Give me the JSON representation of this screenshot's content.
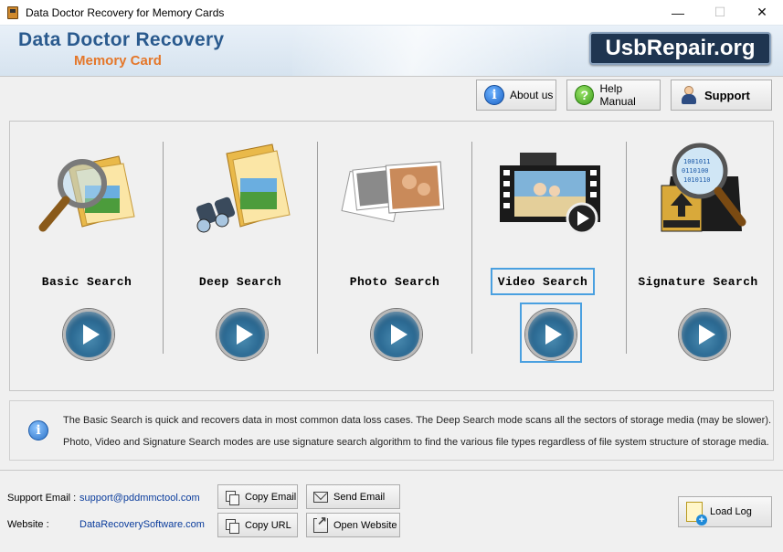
{
  "window": {
    "title": "Data Doctor Recovery for Memory Cards",
    "controls": [
      "—",
      "☐",
      "✕"
    ]
  },
  "banner": {
    "title": "Data Doctor Recovery",
    "subtitle": "Memory Card",
    "badge": "UsbRepair.org"
  },
  "toolbar": {
    "about_label": "About us",
    "help_label": "Help Manual",
    "support_label": "Support"
  },
  "searches": [
    {
      "label": "Basic Search",
      "icon": "magnifier-folder-icon",
      "selected": false
    },
    {
      "label": "Deep Search",
      "icon": "binoculars-folder-icon",
      "selected": false
    },
    {
      "label": "Photo Search",
      "icon": "photos-icon",
      "selected": false
    },
    {
      "label": "Video Search",
      "icon": "video-film-icon",
      "selected": true
    },
    {
      "label": "Signature Search",
      "icon": "memory-card-magnifier-icon",
      "selected": false
    }
  ],
  "info": {
    "line1": "The Basic Search is quick and recovers data in most common data loss cases. The Deep Search mode scans all the sectors of storage media (may be slower).",
    "line2": "Photo, Video and Signature Search modes are use signature search algorithm to find the various file types regardless of file system structure of storage media."
  },
  "bottom": {
    "support_email_label": "Support Email :",
    "support_email": "support@pddmmctool.com",
    "website_label": "Website :",
    "website": "DataRecoverySoftware.com",
    "copy_email": "Copy Email",
    "send_email": "Send Email",
    "copy_url": "Copy URL",
    "open_website": "Open Website",
    "load_log": "Load Log"
  }
}
